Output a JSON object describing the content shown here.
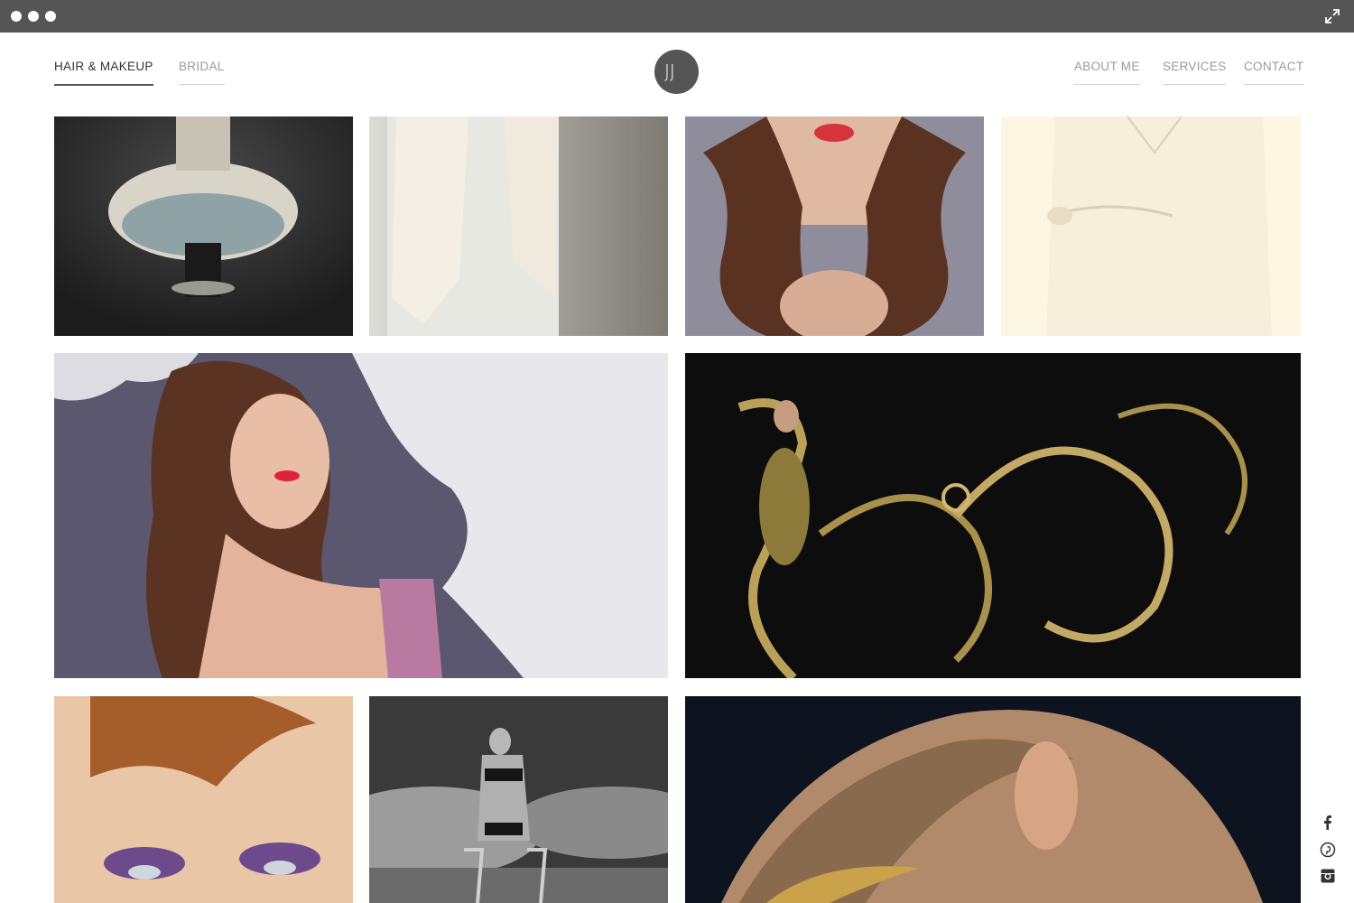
{
  "nav": {
    "left": [
      {
        "label": "HAIR & MAKEUP",
        "active": true
      },
      {
        "label": "BRIDAL",
        "active": false
      }
    ],
    "right": [
      {
        "label": "ABOUT ME"
      },
      {
        "label": "SERVICES"
      },
      {
        "label": "CONTACT"
      }
    ],
    "logo_text": "JJ"
  },
  "chrome": {
    "dot_color": "#ffffff",
    "bar_color": "#555555",
    "expand_icon": "expand-icon"
  },
  "gallery": {
    "photos": [
      {
        "name": "photo-tutu-dress"
      },
      {
        "name": "photo-fur-stole"
      },
      {
        "name": "photo-red-lips-curls"
      },
      {
        "name": "photo-cream-dress"
      },
      {
        "name": "photo-graffiti-wall-portrait"
      },
      {
        "name": "photo-gold-baroque-swirls"
      },
      {
        "name": "photo-purple-eyeshadow"
      },
      {
        "name": "photo-bw-swimsuit"
      },
      {
        "name": "photo-gold-eye-closeup"
      }
    ]
  },
  "social": [
    "facebook-icon",
    "pinterest-icon",
    "instagram-icon"
  ],
  "colors": {
    "accent": "#555555",
    "text": "#333333",
    "muted": "#9a9a9a"
  }
}
